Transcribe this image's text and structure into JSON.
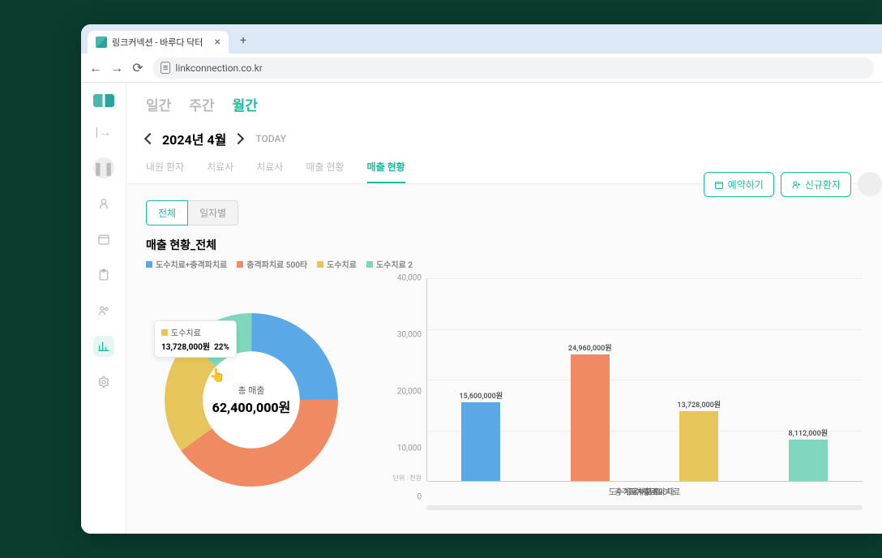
{
  "browser": {
    "tab_title": "링크커넥션 - 바루다 닥터",
    "url": "linkconnection.co.kr"
  },
  "header": {
    "period_tabs": [
      "일간",
      "주간",
      "월간"
    ],
    "period_active": 2,
    "reserve_btn": "예약하기",
    "new_patient_btn": "신규환자",
    "date_label": "2024년 4월",
    "today_label": "TODAY"
  },
  "subtabs": {
    "items": [
      "내원 환자",
      "치료사",
      "치료사",
      "매출 현황",
      "매출 현황"
    ],
    "active": 4
  },
  "pill_tabs": {
    "items": [
      "전체",
      "일자별"
    ],
    "active": 0
  },
  "section": {
    "title": "매출 현황_전체"
  },
  "legend": [
    {
      "label": "도수치료+충격파치료",
      "color": "#5aa9e6"
    },
    {
      "label": "충격파치료 500타",
      "color": "#ef8a62"
    },
    {
      "label": "도수치료",
      "color": "#e6c65a"
    },
    {
      "label": "도수치료 2",
      "color": "#7fd6bd"
    }
  ],
  "donut": {
    "center_label": "총 매출",
    "center_value": "62,400,000원",
    "tooltip": {
      "series": "도수치료",
      "value": "13,728,000원",
      "pct": "22%",
      "color": "#e6c65a"
    }
  },
  "chart_data": {
    "type": "bar",
    "title": "매출 현황_전체",
    "categories": [
      "도수치료+충격파치료",
      "충격파치료 500타",
      "도수치료",
      "도수치료 2"
    ],
    "series": [
      {
        "name": "매출",
        "values": [
          15600000,
          24960000,
          13728000,
          8112000
        ],
        "labels": [
          "15,600,000원",
          "24,960,000원",
          "13,728,000원",
          "8,112,000원"
        ],
        "colors": [
          "#5aa9e6",
          "#ef8a62",
          "#e6c65a",
          "#7fd6bd"
        ]
      }
    ],
    "ylim": [
      0,
      40000
    ],
    "yticks": [
      0,
      10000,
      20000,
      30000,
      40000
    ],
    "ytick_labels": [
      "0",
      "10,000",
      "20,000",
      "30,000",
      "40,000"
    ],
    "unit_label": "단위 : 천원",
    "donut_total": 62400000,
    "donut_slices": [
      {
        "name": "도수치료+충격파치료",
        "value": 15600000,
        "color": "#5aa9e6"
      },
      {
        "name": "충격파치료 500타",
        "value": 24960000,
        "color": "#ef8a62"
      },
      {
        "name": "도수치료",
        "value": 13728000,
        "color": "#e6c65a"
      },
      {
        "name": "도수치료 2",
        "value": 8112000,
        "color": "#7fd6bd"
      }
    ]
  }
}
